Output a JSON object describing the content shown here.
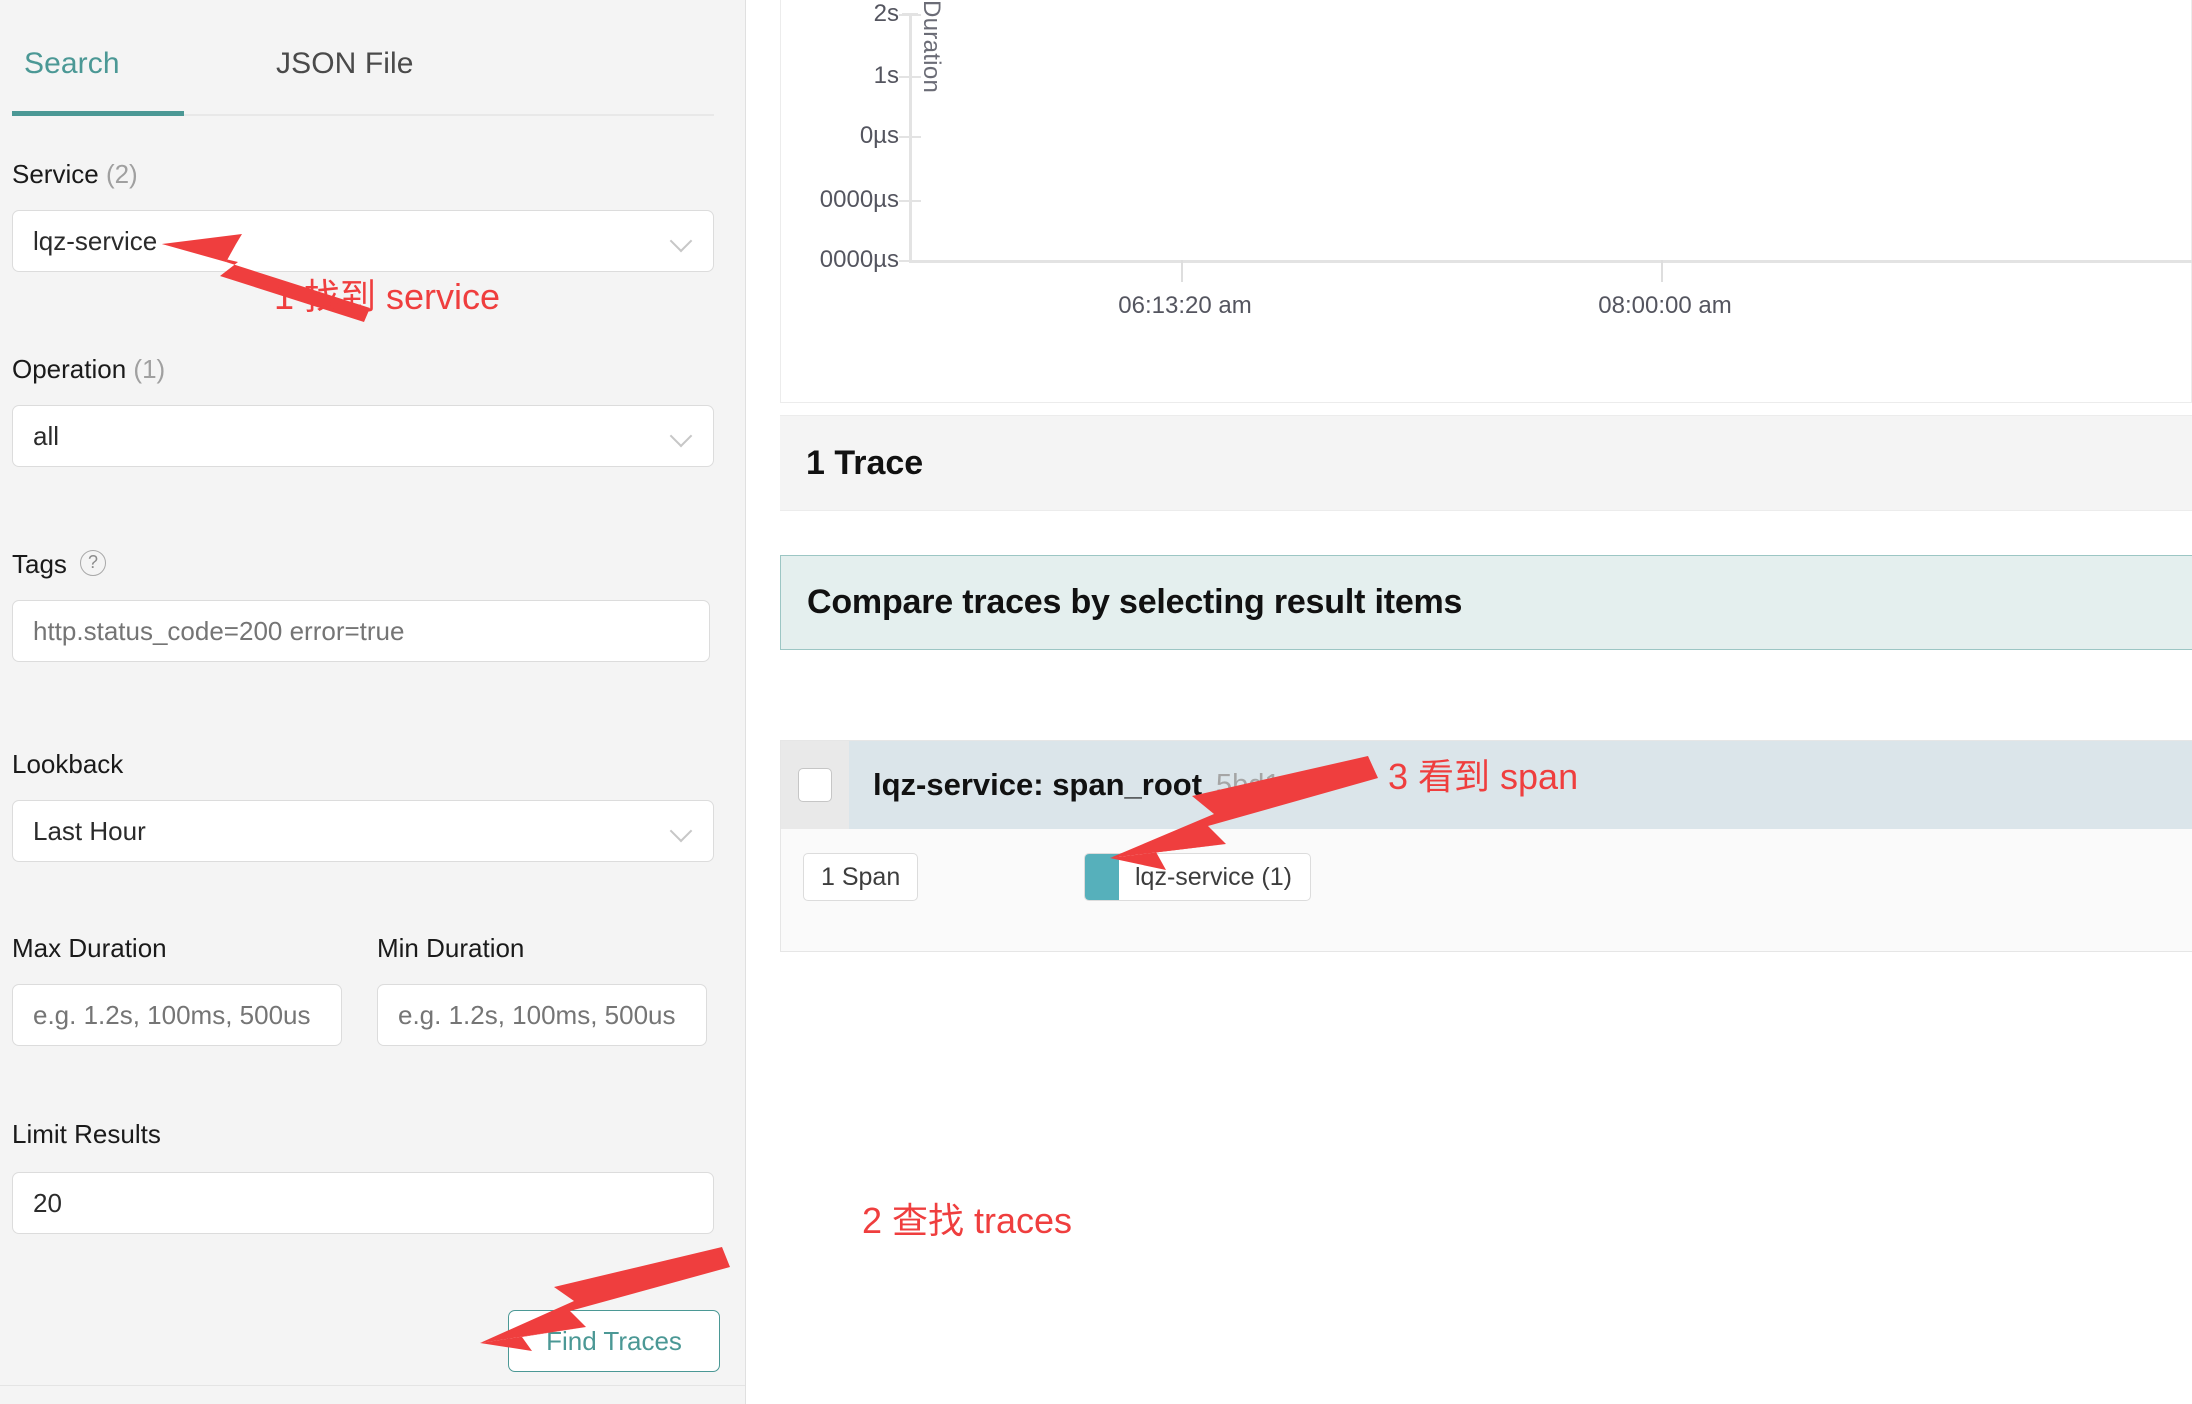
{
  "sidebar": {
    "tabs": [
      {
        "label": "Search",
        "active": true
      },
      {
        "label": "JSON File",
        "active": false
      }
    ],
    "fields": {
      "service": {
        "label": "Service",
        "count": "(2)",
        "value": "lqz-service"
      },
      "operation": {
        "label": "Operation",
        "count": "(1)",
        "value": "all"
      },
      "tags": {
        "label": "Tags",
        "help_icon": "question-circle-icon",
        "placeholder": "http.status_code=200 error=true",
        "value": ""
      },
      "lookback": {
        "label": "Lookback",
        "value": "Last Hour"
      },
      "max_duration": {
        "label": "Max Duration",
        "placeholder": "e.g. 1.2s, 100ms, 500us",
        "value": ""
      },
      "min_duration": {
        "label": "Min Duration",
        "placeholder": "e.g. 1.2s, 100ms, 500us",
        "value": ""
      },
      "limit_results": {
        "label": "Limit Results",
        "value": "20"
      }
    },
    "find_traces_button": "Find Traces"
  },
  "main": {
    "trace_count_label": "1 Trace",
    "compare_banner": "Compare traces by selecting result items",
    "result": {
      "title": "lqz-service: span_root",
      "trace_id": "5bd1a3f",
      "span_count_pill": "1 Span",
      "service_tag": "lqz-service (1)",
      "service_color": "#56b0bb"
    }
  },
  "chart_data": {
    "type": "scatter",
    "title": "",
    "xlabel": "",
    "ylabel": "Duration",
    "x_ticks": [
      "06:13:20 am",
      "08:00:00 am"
    ],
    "y_ticks": [
      "2s",
      "1s",
      "0µs",
      "0000µs",
      "0000µs"
    ],
    "series": [],
    "values": [],
    "grid": false,
    "legend": "none",
    "note": "empty scatter plot area; no plotted points visible"
  },
  "annotations": [
    {
      "text": "1 找到 service",
      "target": "service-select"
    },
    {
      "text": "2 查找 traces",
      "target": "find-traces-button"
    },
    {
      "text": "3 看到 span",
      "target": "trace-result-row"
    }
  ],
  "colors": {
    "accent_teal": "#4b9895",
    "service_teal": "#56b0bb",
    "annotation_red": "#ef3e3e",
    "banner_bg": "#e4efee",
    "row_header_bg": "#dbe5ea"
  }
}
